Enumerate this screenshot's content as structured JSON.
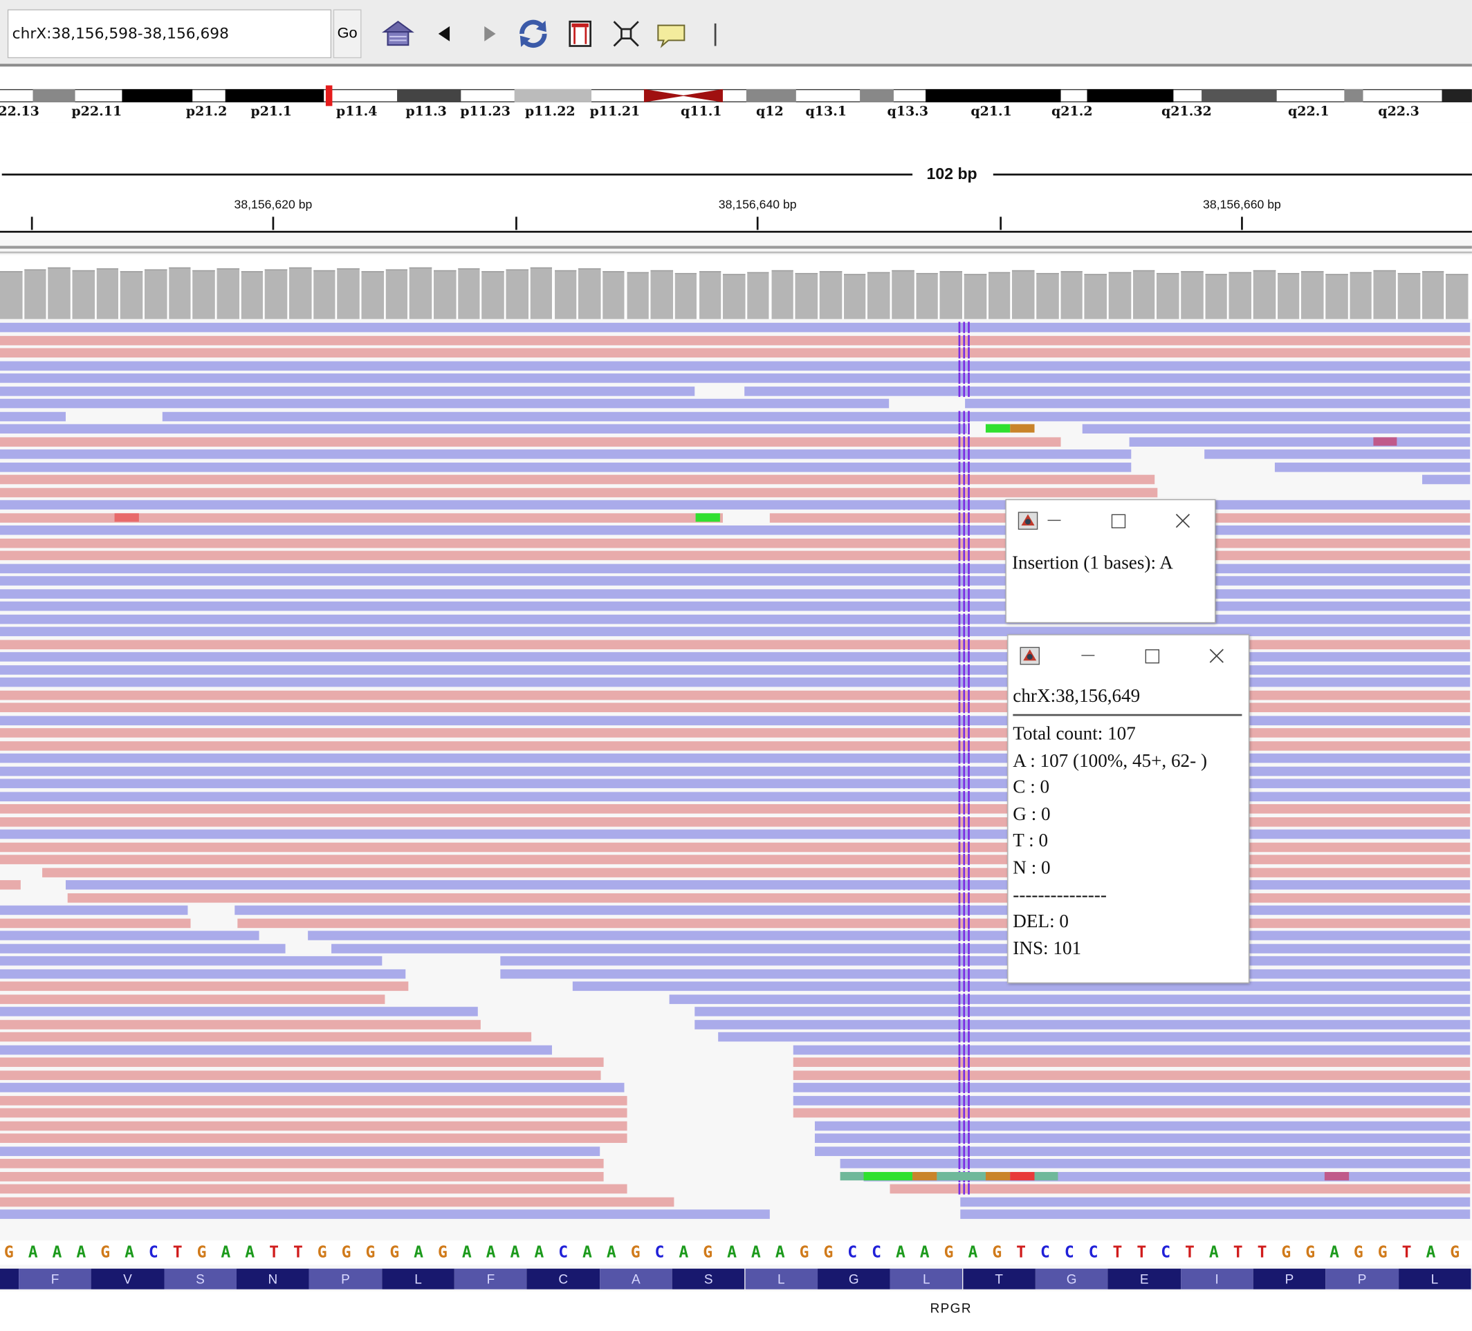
{
  "locus": {
    "value": "chrX:38,156,598-38,156,698",
    "go_label": "Go"
  },
  "toolbar_icons": [
    "home-icon",
    "back-icon",
    "forward-icon",
    "refresh-icon",
    "roi-icon",
    "fit-icon",
    "popup-icon",
    "divider"
  ],
  "cytobands": [
    "22.13",
    "p22.11",
    "p21.2",
    "p21.1",
    "p11.4",
    "p11.3",
    "p11.23",
    "p11.22",
    "p11.21",
    "q11.1",
    "q12",
    "q13.1",
    "q13.3",
    "q21.1",
    "q21.2",
    "q21.32",
    "q22.1",
    "q22.3"
  ],
  "ruler": {
    "span_label": "102 bp",
    "ticks": [
      "38,156,620 bp",
      "38,156,640 bp",
      "38,156,660 bp"
    ]
  },
  "sequence": [
    "G",
    "A",
    "A",
    "A",
    "G",
    "A",
    "C",
    "T",
    "G",
    "A",
    "A",
    "T",
    "T",
    "G",
    "G",
    "G",
    "G",
    "A",
    "G",
    "A",
    "A",
    "A",
    "A",
    "C",
    "A",
    "A",
    "G",
    "C",
    "A",
    "G",
    "A",
    "A",
    "A",
    "G",
    "G",
    "C",
    "C",
    "A",
    "A",
    "G",
    "A",
    "G",
    "T",
    "C",
    "C",
    "C",
    "T",
    "T",
    "C",
    "T",
    "A",
    "T",
    "T",
    "G",
    "G",
    "A",
    "G",
    "G",
    "T",
    "A",
    "G"
  ],
  "translation": [
    "F",
    "V",
    "S",
    "N",
    "P",
    "L",
    "F",
    "C",
    "A",
    "S",
    "L",
    "G",
    "L",
    "T",
    "G",
    "E",
    "I",
    "P",
    "P",
    "L"
  ],
  "gene": "RPGR",
  "colors": {
    "forward_read": "#e8abab",
    "reverse_read": "#aaabea",
    "insertion": "#7b2ee3",
    "coverage": "#b5b5b5",
    "A": "#1c9a1c",
    "C": "#2020d8",
    "G": "#d07a1a",
    "T": "#d01c1c"
  },
  "popup_insertion": {
    "text": "Insertion (1 bases): A"
  },
  "popup_position": {
    "title": "chrX:38,156,649",
    "lines": [
      "Total count: 107",
      "A : 107 (100%, 45+, 62- )",
      "C : 0",
      "G : 0",
      "T : 0",
      "N : 0",
      "---------------",
      "DEL: 0",
      "INS: 101"
    ]
  }
}
